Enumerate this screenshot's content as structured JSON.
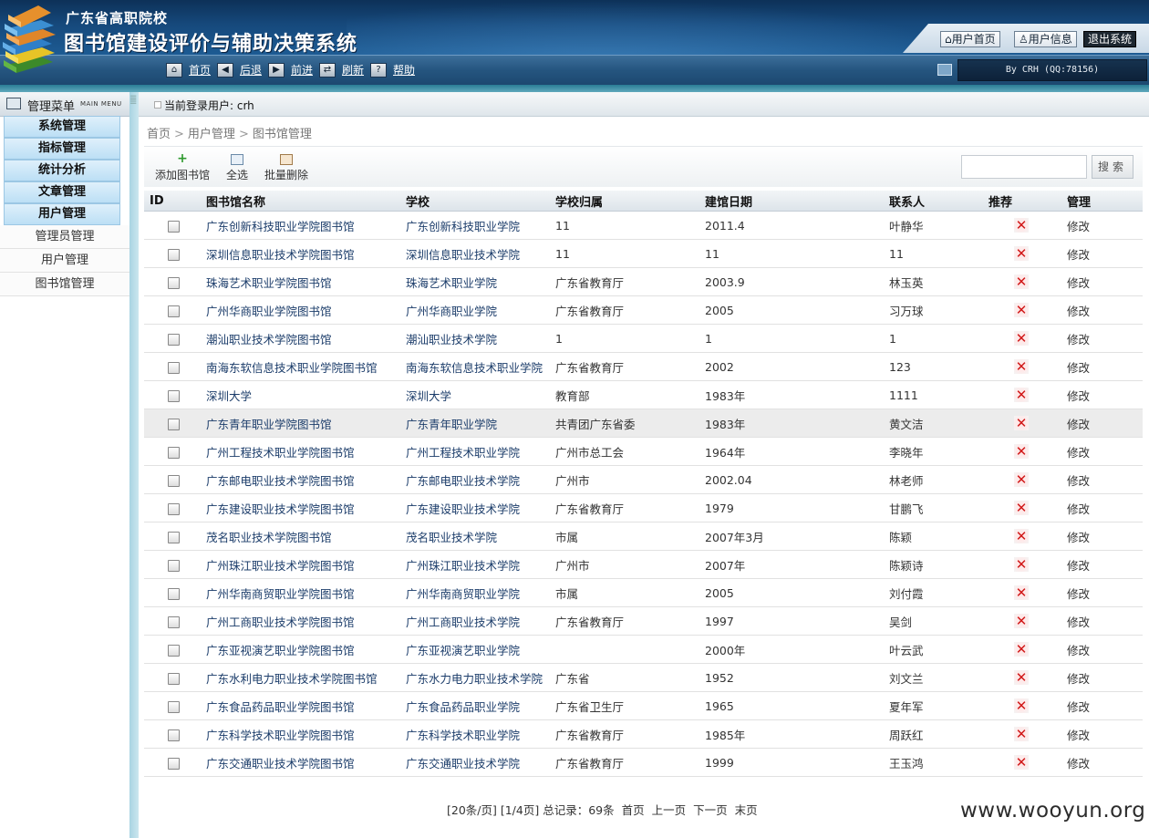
{
  "header": {
    "school": "广东省高职院校",
    "system_title": "图书馆建设评价与辅助决策系统",
    "top_buttons": [
      {
        "label": "⌂用户首页"
      },
      {
        "label": "♙用户信息"
      },
      {
        "label": "退出系统"
      }
    ]
  },
  "nav": {
    "items": [
      {
        "label": "首页",
        "icon": "home-icon"
      },
      {
        "label": "后退",
        "icon": "arrow-left-icon"
      },
      {
        "label": "前进",
        "icon": "arrow-right-icon"
      },
      {
        "label": "刷新",
        "icon": "refresh-icon"
      },
      {
        "label": "帮助",
        "icon": "help-icon"
      }
    ],
    "credit": "By CRH (QQ:78156)"
  },
  "sidebar": {
    "title": "管理菜单",
    "title_en": "MAIN MENU",
    "categories": [
      "系统管理",
      "指标管理",
      "统计分析",
      "文章管理",
      "用户管理"
    ],
    "sub_items": [
      "管理员管理",
      "用户管理",
      "图书馆管理"
    ]
  },
  "login": {
    "text": "当前登录用户: crh"
  },
  "breadcrumb": [
    "首页",
    "用户管理",
    "图书馆管理"
  ],
  "actions": [
    {
      "label": "添加图书馆",
      "icon": "add-icon"
    },
    {
      "label": "全选",
      "icon": "select-all-icon"
    },
    {
      "label": "批量删除",
      "icon": "batch-delete-icon"
    }
  ],
  "search": {
    "button": "搜索",
    "value": ""
  },
  "table": {
    "headers": [
      "ID",
      "图书馆名称",
      "学校",
      "学校归属",
      "建馆日期",
      "联系人",
      "推荐",
      "管理"
    ],
    "edit_label": "修改",
    "rows": [
      {
        "name": "广东创新科技职业学院图书馆",
        "school": "广东创新科技职业学院",
        "owner": "11",
        "date": "2011.4",
        "contact": "叶静华"
      },
      {
        "name": "深圳信息职业技术学院图书馆",
        "school": "深圳信息职业技术学院",
        "owner": "11",
        "date": "11",
        "contact": "11"
      },
      {
        "name": "珠海艺术职业学院图书馆",
        "school": "珠海艺术职业学院",
        "owner": "广东省教育厅",
        "date": "2003.9",
        "contact": "林玉英"
      },
      {
        "name": "广州华商职业学院图书馆",
        "school": "广州华商职业学院",
        "owner": "广东省教育厅",
        "date": "2005",
        "contact": "习万球"
      },
      {
        "name": "潮汕职业技术学院图书馆",
        "school": "潮汕职业技术学院",
        "owner": "1",
        "date": "1",
        "contact": "1"
      },
      {
        "name": "南海东软信息技术职业学院图书馆",
        "school": "南海东软信息技术职业学院",
        "owner": "广东省教育厅",
        "date": "2002",
        "contact": "123"
      },
      {
        "name": "深圳大学",
        "school": "深圳大学",
        "owner": "教育部",
        "date": "1983年",
        "contact": "1111"
      },
      {
        "name": "广东青年职业学院图书馆",
        "school": "广东青年职业学院",
        "owner": "共青团广东省委",
        "date": "1983年",
        "contact": "黄文洁"
      },
      {
        "name": "广州工程技术职业学院图书馆",
        "school": "广州工程技术职业学院",
        "owner": "广州市总工会",
        "date": "1964年",
        "contact": "李晓年"
      },
      {
        "name": "广东邮电职业技术学院图书馆",
        "school": "广东邮电职业技术学院",
        "owner": "广州市",
        "date": "2002.04",
        "contact": "林老师"
      },
      {
        "name": "广东建设职业技术学院图书馆",
        "school": "广东建设职业技术学院",
        "owner": "广东省教育厅",
        "date": "1979",
        "contact": "甘鹏飞"
      },
      {
        "name": "茂名职业技术学院图书馆",
        "school": "茂名职业技术学院",
        "owner": "市属",
        "date": "2007年3月",
        "contact": "陈颖"
      },
      {
        "name": "广州珠江职业技术学院图书馆",
        "school": "广州珠江职业技术学院",
        "owner": "广州市",
        "date": "2007年",
        "contact": "陈颖诗"
      },
      {
        "name": "广州华南商贸职业学院图书馆",
        "school": "广州华南商贸职业学院",
        "owner": "市属",
        "date": "2005",
        "contact": "刘付霞"
      },
      {
        "name": "广州工商职业技术学院图书馆",
        "school": "广州工商职业技术学院",
        "owner": "广东省教育厅",
        "date": "1997",
        "contact": "吴剑"
      },
      {
        "name": "广东亚视演艺职业学院图书馆",
        "school": "广东亚视演艺职业学院",
        "owner": "",
        "date": "2000年",
        "contact": "叶云武"
      },
      {
        "name": "广东水利电力职业技术学院图书馆",
        "school": "广东水力电力职业技术学院",
        "owner": "广东省",
        "date": "1952",
        "contact": "刘文兰"
      },
      {
        "name": "广东食品药品职业学院图书馆",
        "school": "广东食品药品职业学院",
        "owner": "广东省卫生厅",
        "date": "1965",
        "contact": "夏年军"
      },
      {
        "name": "广东科学技术职业学院图书馆",
        "school": "广东科学技术职业学院",
        "owner": "广东省教育厅",
        "date": "1985年",
        "contact": "周跃红"
      },
      {
        "name": "广东交通职业技术学院图书馆",
        "school": "广东交通职业技术学院",
        "owner": "广东省教育厅",
        "date": "1999",
        "contact": "王玉鸿"
      }
    ]
  },
  "pager": {
    "info": "[20条/页] [1/4页] 总记录：69条",
    "first": "首页",
    "prev": "上一页",
    "next": "下一页",
    "last": "末页"
  },
  "watermark": "www.wooyun.org"
}
